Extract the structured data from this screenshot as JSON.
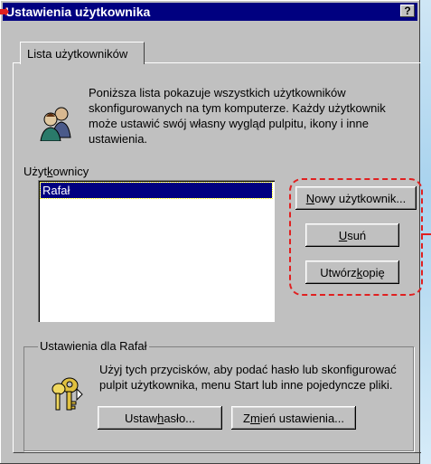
{
  "window": {
    "title": "Ustawienia użytkownika",
    "help_label": "?"
  },
  "tab": {
    "label": "Lista użytkowników"
  },
  "description": "Poniższa lista pokazuje wszystkich użytkowników skonfigurowanych na tym komputerze. Każdy użytkownik może ustawić swój własny wygląd pulpitu, ikony i inne ustawienia.",
  "users": {
    "label_pre": "Użyt",
    "label_key": "k",
    "label_post": "ownicy",
    "items": [
      "Rafał"
    ]
  },
  "buttons": {
    "new_user_key": "N",
    "new_user_rest": "owy użytkownik...",
    "delete_key": "U",
    "delete_rest": "suń",
    "copy_pre": "Utwórz ",
    "copy_key": "k",
    "copy_rest": "opię"
  },
  "group": {
    "title": "Ustawienia dla Rafał",
    "description": "Użyj tych przycisków, aby podać hasło lub skonfigurować pulpit użytkownika, menu Start lub inne pojedyncze pliki.",
    "set_password_pre": "Ustaw ",
    "set_password_key": "h",
    "set_password_rest": "asło...",
    "change_settings_pre": "Z",
    "change_settings_key": "m",
    "change_settings_rest": "ień ustawienia..."
  },
  "colors": {
    "titlebar": "#000080",
    "face": "#c0c0c0",
    "annotation": "#e02020",
    "selection": "#000080"
  },
  "icons": {
    "users": "users-icon",
    "keys": "keys-icon",
    "pointer": "red-arrow-icon"
  }
}
